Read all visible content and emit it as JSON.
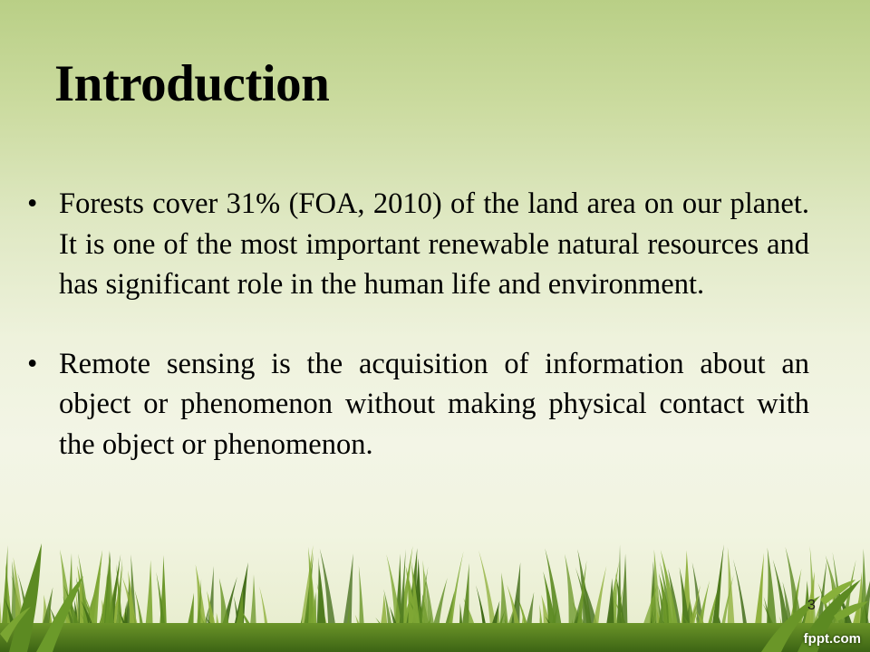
{
  "slide": {
    "title": "Introduction",
    "bullets": [
      {
        "text": "Forests cover 31% (FOA, 2010) of the land area on our planet. It is one of the most important renewable natural resources and has significant role in the human life and environment."
      },
      {
        "text": "Remote sensing is the acquisition of information about an object or phenomenon without making physical contact with the object or phenomenon."
      }
    ],
    "bullet_glyph": "•",
    "page_number": "3",
    "watermark": "fppt.com"
  },
  "colors": {
    "background_top": "#b9cf86",
    "background_middle": "#f3f5e6",
    "grass_dark": "#4f7a1f",
    "grass_light": "#8fb03c",
    "text": "#000000"
  }
}
